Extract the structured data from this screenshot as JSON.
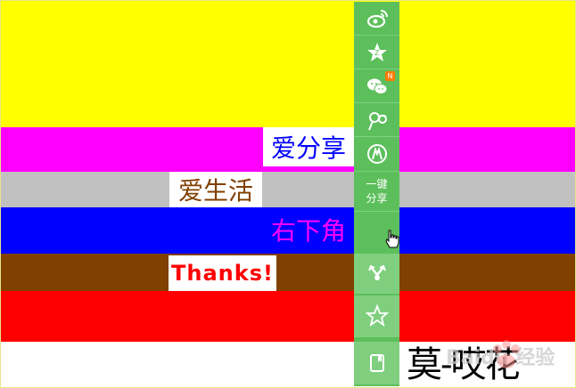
{
  "labels": {
    "line1": "爱分享",
    "line2": "爱生活",
    "line3": "右下角",
    "line4": "Thanks!"
  },
  "label_colors": {
    "line1": "#0000ff",
    "line2": "#804000",
    "line3": "#ff00ff",
    "line4": "#ff0000"
  },
  "bands": [
    "#ffff00",
    "#ff00ff",
    "#c0c0c0",
    "#0000ff",
    "#804000",
    "#ff0000",
    "#ffffff"
  ],
  "share_rail": {
    "items": [
      {
        "name": "weibo-icon"
      },
      {
        "name": "qzone-icon"
      },
      {
        "name": "wechat-icon",
        "badge": "N"
      },
      {
        "name": "tencent-weibo-icon"
      },
      {
        "name": "renren-icon"
      },
      {
        "name": "one-click-share",
        "text": "一键\n分享"
      },
      {
        "name": "share-more-icon"
      },
      {
        "name": "favorite-star-icon"
      },
      {
        "name": "bookmark-icon"
      }
    ],
    "one_click_line1": "一键",
    "one_click_line2": "分享"
  },
  "watermark": {
    "text": "莫-哎花",
    "logo": "Baidu 经验"
  }
}
